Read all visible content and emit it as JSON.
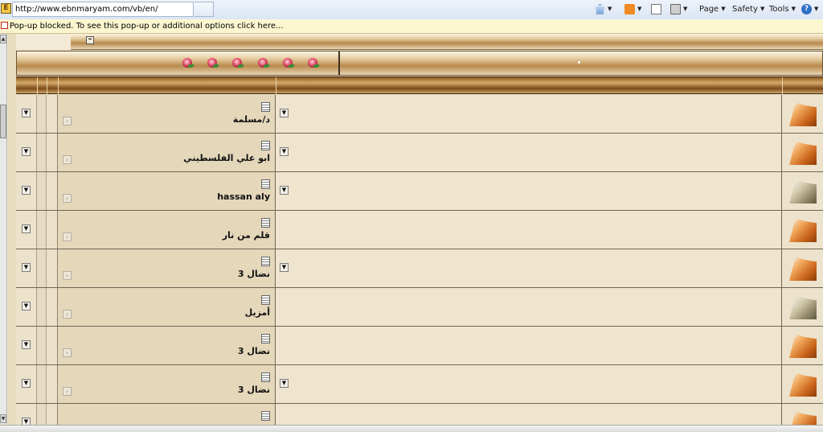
{
  "browser": {
    "url": "http://www.ebnmaryam.com/vb/en/",
    "favicon_glyph": "E",
    "commands": {
      "page": "Page",
      "safety": "Safety",
      "tools": "Tools",
      "help_glyph": "?"
    },
    "popup_message": "Pop-up blocked. To see this pop-up or additional options click here..."
  },
  "icons": {
    "home": "home-icon",
    "feeds": "feed-icon",
    "mail": "mail-icon",
    "print": "print-icon",
    "help": "help-icon",
    "collapse": "collapse-icon",
    "dropdown": "arrow-down-icon",
    "go": "go-to-post-icon",
    "post": "page-icon",
    "folder_new": "folder-new-icon",
    "folder_old": "folder-old-icon",
    "decoration": "rose-icon"
  },
  "colors": {
    "page_background": "#efe4cc",
    "bronze_band": "#b98a4d",
    "header_dark": "#7b4a18",
    "grid_lines": "#6f6556",
    "popup_bar": "#fbf6cf"
  },
  "decorative_roses": 6,
  "rows": [
    {
      "author": "د/مسلمة",
      "has_menu": true,
      "folder": "new"
    },
    {
      "author": "ابو علي الفلسطيني",
      "has_menu": true,
      "folder": "new"
    },
    {
      "author": "hassan aly",
      "has_menu": true,
      "folder": "old"
    },
    {
      "author": "قلم من نار",
      "has_menu": false,
      "folder": "new"
    },
    {
      "author": "نضال 3",
      "has_menu": true,
      "folder": "new"
    },
    {
      "author": "أمزيل",
      "has_menu": false,
      "folder": "old"
    },
    {
      "author": "نضال 3",
      "has_menu": false,
      "folder": "new"
    },
    {
      "author": "نضال 3",
      "has_menu": true,
      "folder": "new"
    },
    {
      "author": "",
      "has_menu": false,
      "folder": "new"
    }
  ]
}
